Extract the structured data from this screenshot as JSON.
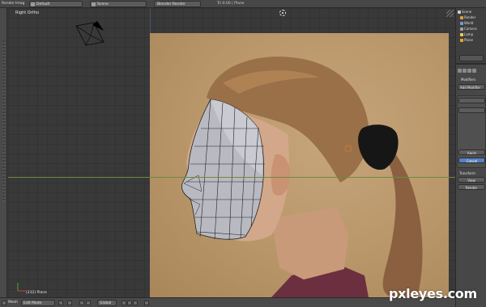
{
  "header": {
    "editor_type": "Render",
    "menu_image": "Imag",
    "layout_name": "Default",
    "scene_name": "Scene",
    "render_engine": "Blender Render",
    "stats": "Tri:0.00 | Plane"
  },
  "viewport": {
    "view_label": "Right Ortho",
    "object_label": "(232) Plane"
  },
  "footer": {
    "mesh_menu": "Mesh",
    "mode": "Edit Mode",
    "orientation": "Global"
  },
  "outliner": {
    "items": [
      {
        "label": "Scene",
        "color": "#cfcfcf"
      },
      {
        "label": "Render",
        "color": "#e0a040"
      },
      {
        "label": "World",
        "color": "#6fa0d0"
      },
      {
        "label": "Camera",
        "color": "#a0a0a0"
      },
      {
        "label": "Lamp",
        "color": "#e8d060"
      },
      {
        "label": "Plane",
        "color": "#f0a030"
      }
    ]
  },
  "properties": {
    "modifiers_title": "Modifiers",
    "add_modifier": "Add Modifier",
    "apply": "Apply",
    "cancel": "Cancel",
    "view": "View",
    "render": "Render",
    "transform": "Transform"
  },
  "watermark": "pxleyes.com",
  "colors": {
    "viewport_bg": "#393939",
    "photo_bg": "#b89669",
    "selected_button": "#5680c2",
    "x_axis": "#6b8b3a"
  }
}
